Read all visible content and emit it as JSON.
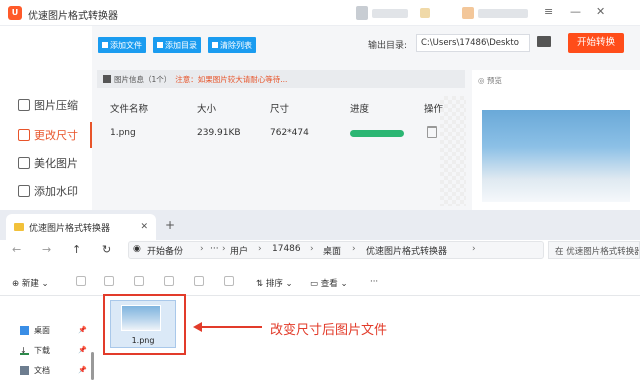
{
  "app": {
    "title": "优速图片格式转换器",
    "toolbar": {
      "add_file": "添加文件",
      "add_dir": "添加目录",
      "clear": "清除列表"
    },
    "output_label": "输出目录:",
    "output_path": "C:\\Users\\17486\\Deskto",
    "start_button": "开始转换",
    "sidebar": [
      {
        "label": "图片压缩"
      },
      {
        "label": "更改尺寸",
        "active": true
      },
      {
        "label": "美化图片"
      },
      {
        "label": "添加水印"
      }
    ],
    "info": {
      "label": "图片信息（1个）",
      "warning": "注意：如果图片较大请耐心等待..."
    },
    "table": {
      "headers": [
        "文件名称",
        "大小",
        "尺寸",
        "进度",
        "操作"
      ],
      "rows": [
        {
          "name": "1.png",
          "size": "239.91KB",
          "dims": "762*474",
          "progress": 1.0
        }
      ]
    },
    "preview_label": "预览"
  },
  "explorer": {
    "tab_title": "优速图片格式转换器",
    "breadcrumbs": [
      "开始备份",
      "用户",
      "17486",
      "桌面",
      "优速图片格式转换器"
    ],
    "search_placeholder": "在 优速图片格式转换器",
    "commands": {
      "new": "新建",
      "sort": "排序",
      "view": "查看",
      "more": "···"
    },
    "nav_pane": [
      {
        "label": "桌面"
      },
      {
        "label": "下载"
      },
      {
        "label": "文档"
      }
    ],
    "file": {
      "name": "1.png"
    }
  },
  "annotation": "改变尺寸后图片文件",
  "colors": {
    "accent": "#e8542a",
    "start_button": "#ff4d1a",
    "toolbar_blue": "#1a9cf0",
    "progress": "#2bb673",
    "annotation_red": "#e23b2a"
  }
}
